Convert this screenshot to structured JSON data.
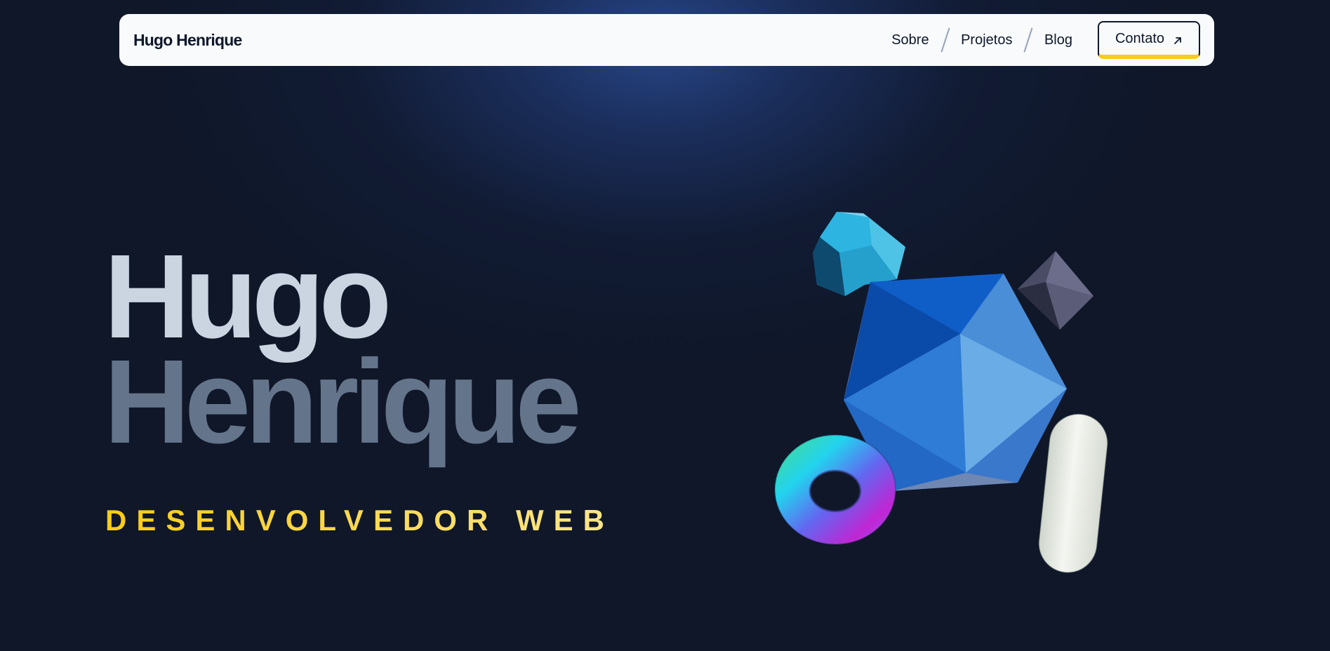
{
  "navbar": {
    "brand": "Hugo Henrique",
    "links": [
      "Sobre",
      "Projetos",
      "Blog"
    ],
    "contact_label": "Contato",
    "contact_icon": "arrow-up-right-icon"
  },
  "hero": {
    "first_name": "Hugo",
    "last_name": "Henrique",
    "role": "DESENVOLVEDOR WEB"
  },
  "colors": {
    "background": "#0f1729",
    "navbar_bg": "#f8fafc",
    "accent": "#facc15",
    "first_name": "#cbd5e1",
    "last_name": "#64748b"
  },
  "illustration": {
    "shapes": [
      "dodecahedron-shape",
      "icosahedron-shape",
      "octahedron-shape",
      "torus-shape",
      "capsule-shape"
    ]
  }
}
